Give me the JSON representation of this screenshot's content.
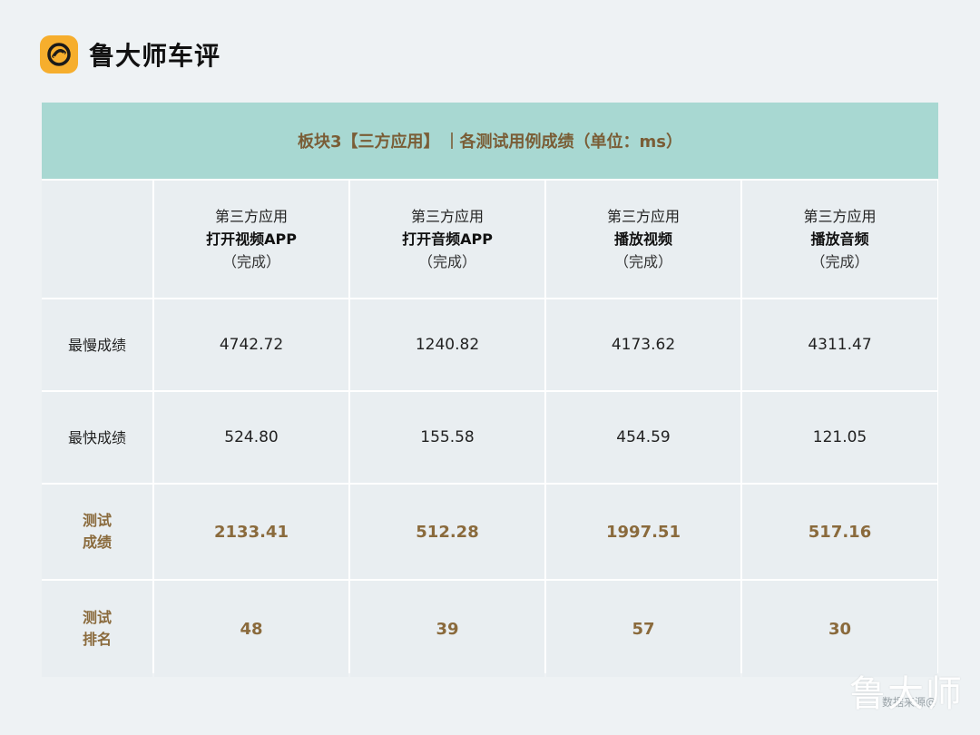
{
  "brand": {
    "name": "鲁大师车评",
    "logo_color": "#f6ae2d"
  },
  "table": {
    "title_left": "板块3【三方应用】",
    "title_right": "各测试用例成绩（单位：ms）",
    "title_bg": "#a8d8d2",
    "accent": "#8a6a3c",
    "columns": [
      {
        "line1": "第三方应用",
        "line2": "打开视频APP",
        "line3": "（完成）"
      },
      {
        "line1": "第三方应用",
        "line2": "打开音频APP",
        "line3": "（完成）"
      },
      {
        "line1": "第三方应用",
        "line2": "播放视频",
        "line3": "（完成）"
      },
      {
        "line1": "第三方应用",
        "line2": "播放音频",
        "line3": "（完成）"
      }
    ],
    "rows": [
      {
        "label": "最慢成绩",
        "values": [
          "4742.72",
          "1240.82",
          "4173.62",
          "4311.47"
        ]
      },
      {
        "label": "最快成绩",
        "values": [
          "524.80",
          "155.58",
          "454.59",
          "121.05"
        ]
      },
      {
        "label_line1": "测试",
        "label_line2": "成绩",
        "values": [
          "2133.41",
          "512.28",
          "1997.51",
          "517.16"
        ]
      },
      {
        "label_line1": "测试",
        "label_line2": "排名",
        "values": [
          "48",
          "39",
          "57",
          "30"
        ]
      }
    ]
  },
  "watermark": {
    "small": "数据来源@",
    "big": "鲁大师"
  }
}
